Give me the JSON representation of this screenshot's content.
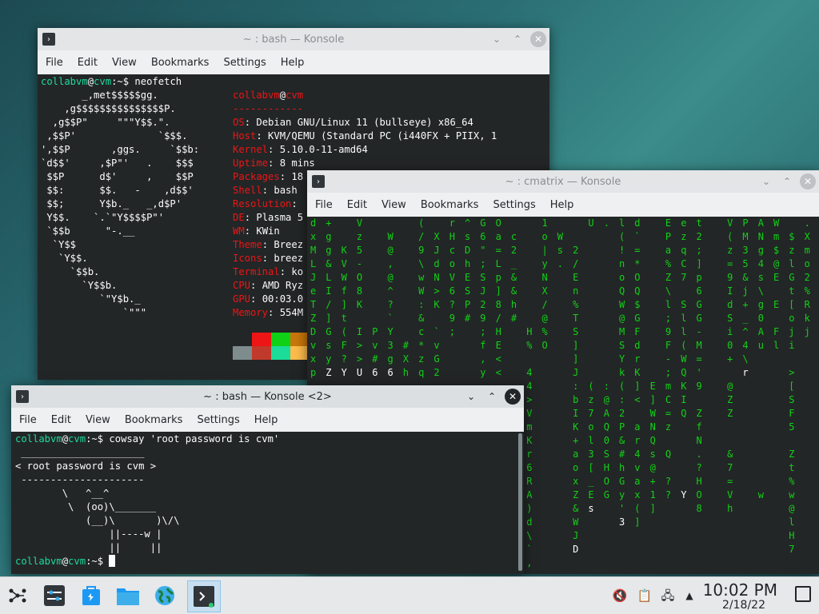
{
  "menu_labels": [
    "File",
    "Edit",
    "View",
    "Bookmarks",
    "Settings",
    "Help"
  ],
  "windows": {
    "neofetch": {
      "title": "~ : bash — Konsole"
    },
    "cmatrix": {
      "title": "~ : cmatrix — Konsole"
    },
    "cowsay": {
      "title": "~ : bash — Konsole <2>"
    }
  },
  "neofetch": {
    "prompt_user": "collabvm",
    "prompt_at": "@",
    "prompt_host": "cvm",
    "prompt_path": ":~$ ",
    "command": "neofetch",
    "logo_lines": [
      "       _,met$$$$$gg.",
      "    ,g$$$$$$$$$$$$$$$P.",
      "  ,g$$P\"     \"\"\"Y$$.\".",
      " ,$$P'              `$$$.",
      "',$$P       ,ggs.     `$$b:",
      "`d$$'     ,$P\"'   .    $$$",
      " $$P      d$'     ,    $$P",
      " $$:      $$.   -    ,d$$'",
      " $$;      Y$b._   _,d$P'",
      " Y$$.    `.`\"Y$$$$P\"'",
      " `$$b      \"-.__",
      "  `Y$$",
      "   `Y$$.",
      "     `$$b.",
      "       `Y$$b.",
      "          `\"Y$b._",
      "              `\"\"\""
    ],
    "header_user": "collabvm",
    "header_at": "@",
    "header_host": "cvm",
    "separator": "------------",
    "info": [
      {
        "key": "OS",
        "value": "Debian GNU/Linux 11 (bullseye) x86_64"
      },
      {
        "key": "Host",
        "value": "KVM/QEMU (Standard PC (i440FX + PIIX, 1"
      },
      {
        "key": "Kernel",
        "value": "5.10.0-11-amd64"
      },
      {
        "key": "Uptime",
        "value": "8 mins"
      },
      {
        "key": "Packages",
        "value": "18"
      },
      {
        "key": "Shell",
        "value": "bash"
      },
      {
        "key": "Resolution",
        "value": ""
      },
      {
        "key": "DE",
        "value": "Plasma 5"
      },
      {
        "key": "WM",
        "value": "KWin"
      },
      {
        "key": "Theme",
        "value": "Breez"
      },
      {
        "key": "Icons",
        "value": "breez"
      },
      {
        "key": "Terminal",
        "value": "ko"
      },
      {
        "key": "CPU",
        "value": "AMD Ryz"
      },
      {
        "key": "GPU",
        "value": "00:03.0"
      },
      {
        "key": "Memory",
        "value": "554M"
      }
    ],
    "palette_top": [
      "#232627",
      "#ed1515",
      "#11d116",
      "#c8770b"
    ],
    "palette_bottom": [
      "#7f8c8d",
      "#c0392b",
      "#1cdc9a",
      "#fdbc4b"
    ]
  },
  "cowsay": {
    "prompt_user": "collabvm",
    "prompt_at": "@",
    "prompt_host": "cvm",
    "prompt_path": ":~$ ",
    "command": "cowsay 'root password is cvm'",
    "bubble_top": " _____________________",
    "bubble_text": "< root password is cvm >",
    "bubble_bottom": " ---------------------",
    "cow": [
      "        \\   ^__^",
      "         \\  (oo)\\_______",
      "            (__)\\       )\\/\\",
      "                ||----w |",
      "                ||     ||"
    ],
    "prompt2_user": "collabvm",
    "prompt2_host": "cvm",
    "prompt2_path": ":~$ "
  },
  "cmatrix_columns": [
    "d\nx\nM\nL\nJ\ne\nT\nZ\nD\nv\nx\np",
    "+\ng\ng\n&\nL\nI\n/\n]\nG\ns\ny\nZ",
    "\n\nK\nV\nW\nf\n]\nt\n(\nF\n?\nY",
    "V\nz\n5\n-\nO\n8\nK\n \nI\n>\n>\nU",
    "\n\n\n\n\n\n\n\nP\nv\n#\n6",
    "\nW\n@\n,\n@\n^\n?\n`\nY\n3\ng\n6",
    "\n\n\n\n\n\n\n\n\n#\nX\nh",
    "(\n/\n9\n\\\nw\nW\n:\n&\nc\n*\nz\nq",
    "\nX\nJ\nd\nN\n>\nK\n\n`\nv\nG\n2",
    "r\nH\nc\no\nV\n6\n?\n9\n;\n\n\n",
    "^\ns\nD\nh\nE\nS\nP\n#\n\n\n\n",
    "G\n6\n\"\n;\nS\nJ\n2\n9\n;\nf\n,\ny",
    "O\na\n=\nL\np\n]\n8\n/\nH\nE\n<\n<",
    "\nc\n2\n_\n&\n&\nh\n#\n\n\n\n",
    "\n\n\n\n\n\n\n\nH\n%\n\n4\n4\n>\nV\nm\nK\nr\n6\nR\nA\n)\nd\n\\\n`\n,\nm",
    "1\no\n|\ny\nN\nX\n/\n@\n%\nO\n\n\n\n\n\n\n\n\n\n\n\n\n\n\n\n\n\nY",
    "\nW\ns\n.\n\n\n\n\n\n\n\n\n\n\n\n\n\n\n\n\n\n\n\n\n\n\n\nH",
    "\n\n2\n/\nE\nn\n%\nT\nS\n]\n]\nJ\n:\nb\nI\nK\n+\na\no\nx\nZ\n&\nW\nJ\nD",
    "U\n\n\n\n\n\n\n\n\n\n\n\n(\nz\n7\no\nl\n3\n[\n_\nE\ns",
    ".\n\n\n\n\n\n\n\n\n\n\n\n:\n@\nA\nQ\n0\nS\nH\nO\nG",
    "l\n(\n!\nn\no\nQ\nW\n@\nM\nS\nY\nk\n(\n:\n2\nP\n&\n#\nh\nG\ny\n'\n3",
    "d\n`\n=\n*\nO\nQ\n$\nG\nF\nd\nr\nK\n]\n<\n \na\nr\n4\nv\na\nx\n(\n]",
    "\n\n\n\n\n\n\n\n\n\n\n\nE\n]\nW\nN\nQ\ns\n@\n+\n1\n]",
    "E\nP\na\n%\nZ\n\\\nl\n;\n9\nF\n-\n;\nm\nC\n=\nz\n \nQ\n \n?\n?",
    "e\nz\nq\nC\n7\n\nS\nl\nl\n(\nW\nQ\nK\nI\nQ\n\n\n\n\n\nY",
    "t\n2\n;\n]\np\n6\nG\nG\n-\nM\n=\n'\n9\n\nZ\nf\nN\n.\n?\nH\nO\n8",
    "\n\n\n\n\n\n\n\n\n\n\n\n\n\n\n\n\n\n\n\n\n",
    "V\n(\nz\n=\n9\nI\nd\nS\ni\n0\n+\n\n@\nZ\nZ\n\n\n&\n7\n=\nV\nh",
    "P\nM\n3\n5\n&\nj\n+\n_\n^\n4\n\\\nr",
    "A\nN\ng\n4\ns\n\\\ng\n0\nA\nu\n\n\n\n\n\n\n\n\n\n\nw",
    "W\nm\n$\n@\nE\n\nE\n\nF\nl",
    "\n$\nz\nl\nG\nt\n[\no\nj\ni\n\n>\n[\nS\nF\n5\n\nZ\nt\n%\nw\n@\nl\nH\n7",
    ".\nX\nm\no\n2\n%\nR\nk\nj\n\n\n\n\n\n\n\n\n\n\n\n\n\n\n\n"
  ],
  "taskbar": {
    "clock_time": "10:02 PM",
    "clock_date": "2/18/22"
  }
}
